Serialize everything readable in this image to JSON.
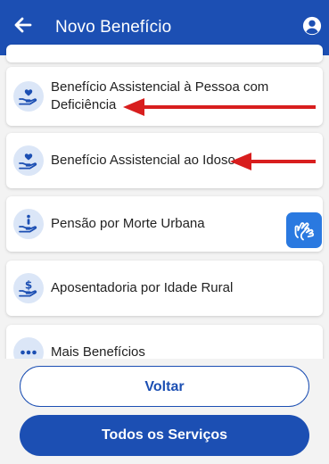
{
  "header": {
    "title": "Novo Benefício",
    "back_icon": "arrow-left-icon",
    "user_icon": "user-circle-icon"
  },
  "items": [
    {
      "label": "Benefício Assistencial à Pessoa com Deficiência",
      "icon": "heart-hand-icon",
      "highlighted": true
    },
    {
      "label": "Benefício Assistencial ao Idoso",
      "icon": "heart-hand-icon",
      "highlighted": true
    },
    {
      "label": "Pensão por Morte Urbana",
      "icon": "person-hand-icon",
      "highlighted": false
    },
    {
      "label": "Aposentadoria por Idade Rural",
      "icon": "dollar-hand-icon",
      "highlighted": false
    },
    {
      "label": "Mais Benefícios",
      "icon": "more-dots-icon",
      "highlighted": false
    }
  ],
  "libras_button": {
    "icon": "sign-language-icon"
  },
  "footer": {
    "back_label": "Voltar",
    "all_services_label": "Todos os Serviços"
  },
  "colors": {
    "primary": "#1c4fb3",
    "annotation_arrow": "#d81e1e",
    "icon_bg": "#dbe6f7",
    "libras_bg": "#2a79e0"
  }
}
